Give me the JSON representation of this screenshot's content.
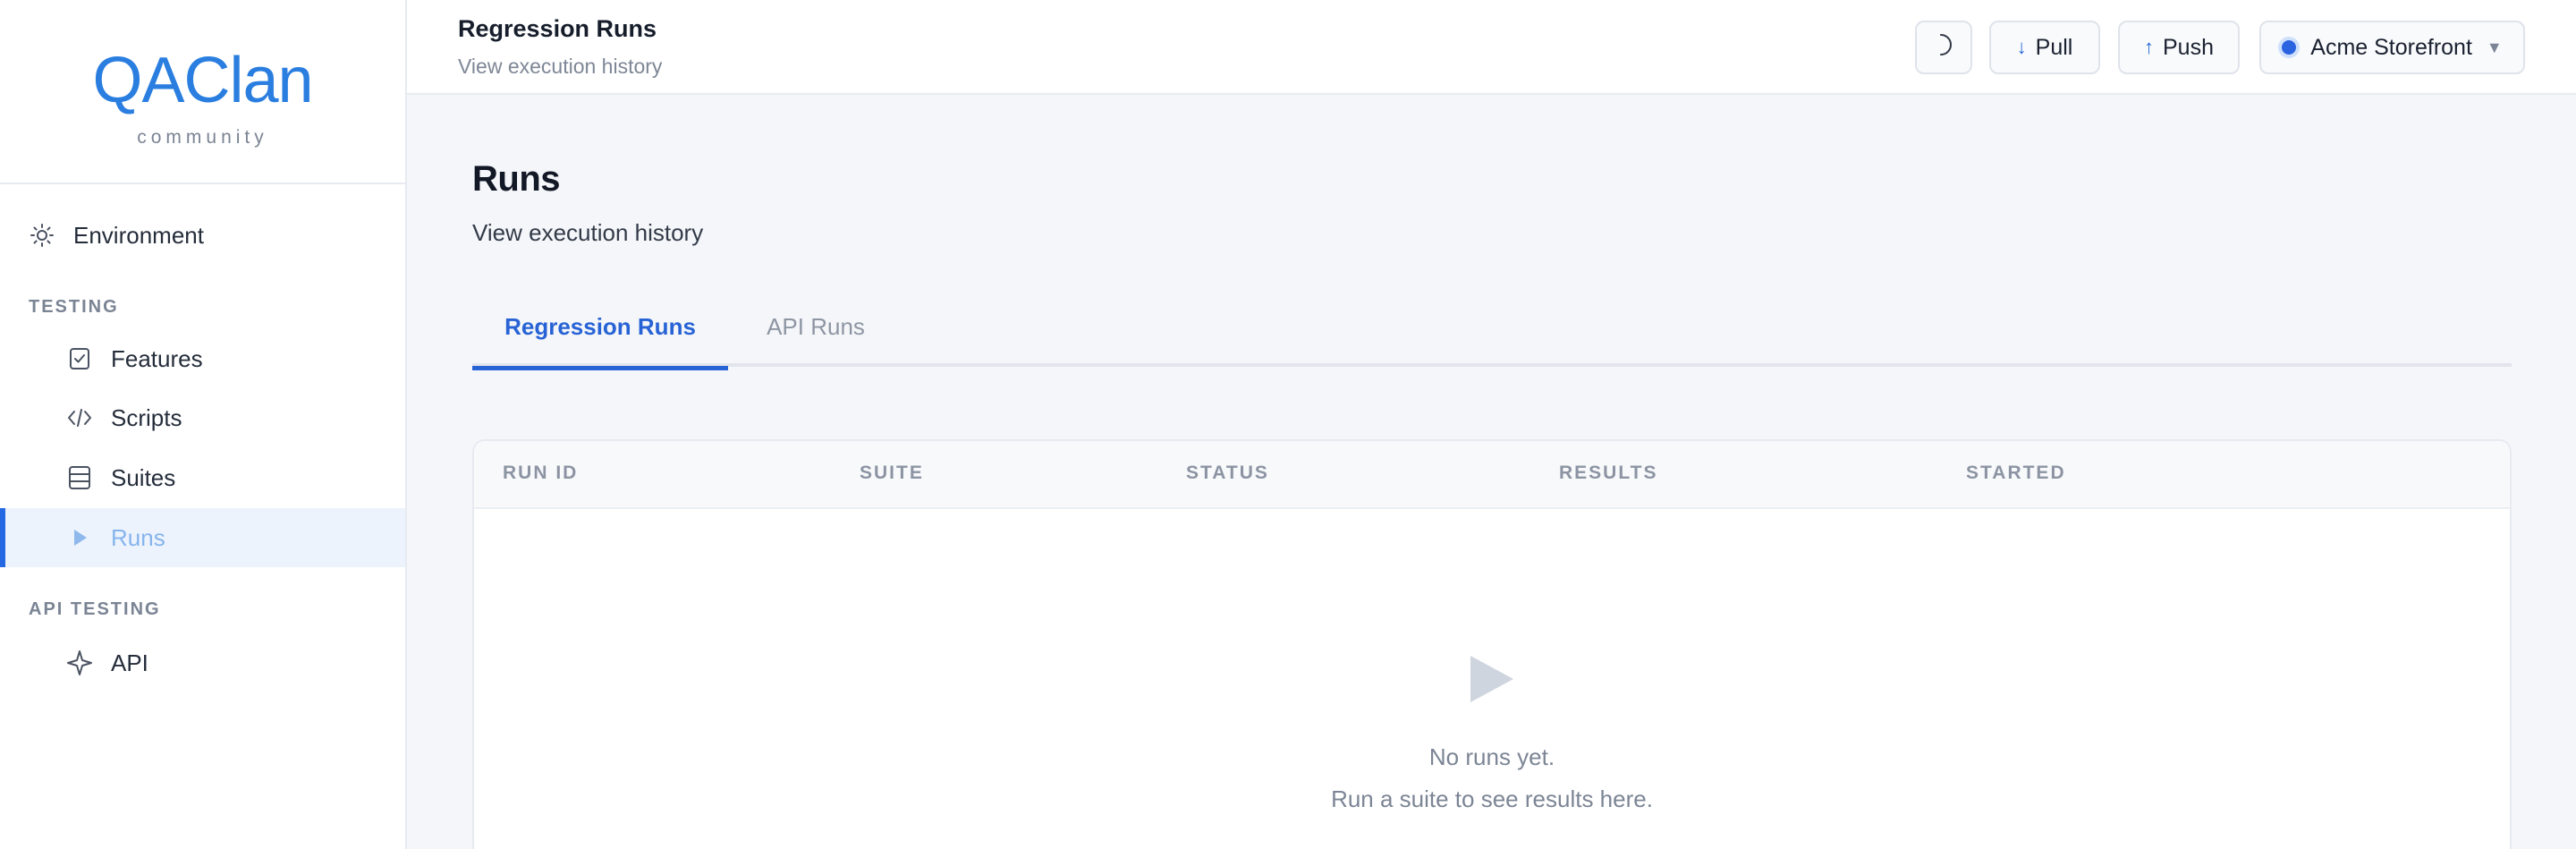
{
  "brand": {
    "logo_text": "QAClan",
    "sub": "community"
  },
  "sidebar": {
    "environment_label": "Environment",
    "section_testing": "TESTING",
    "section_api": "API TESTING",
    "items": [
      {
        "label": "Features",
        "icon": "checklist-icon"
      },
      {
        "label": "Scripts",
        "icon": "code-icon"
      },
      {
        "label": "Suites",
        "icon": "layers-icon"
      },
      {
        "label": "Runs",
        "icon": "play-icon",
        "active": true
      },
      {
        "label": "API",
        "icon": "sparkle-icon"
      }
    ]
  },
  "topbar": {
    "title": "Regression Runs",
    "subtitle": "View execution history",
    "theme_icon": "moon-icon",
    "pull_label": "Pull",
    "push_label": "Push",
    "project_label": "Acme Storefront"
  },
  "main": {
    "title": "Runs",
    "subtitle": "View execution history",
    "tabs": [
      {
        "label": "Regression Runs",
        "active": true
      },
      {
        "label": "API Runs",
        "active": false
      }
    ],
    "table": {
      "columns": [
        "RUN ID",
        "SUITE",
        "STATUS",
        "RESULTS",
        "STARTED"
      ],
      "rows": [],
      "empty_line1": "No runs yet.",
      "empty_line2": "Run a suite to see results here."
    }
  },
  "colors": {
    "accent": "#2863d6",
    "logo": "#2a7ee0",
    "active_bg": "#ecf3fd"
  }
}
